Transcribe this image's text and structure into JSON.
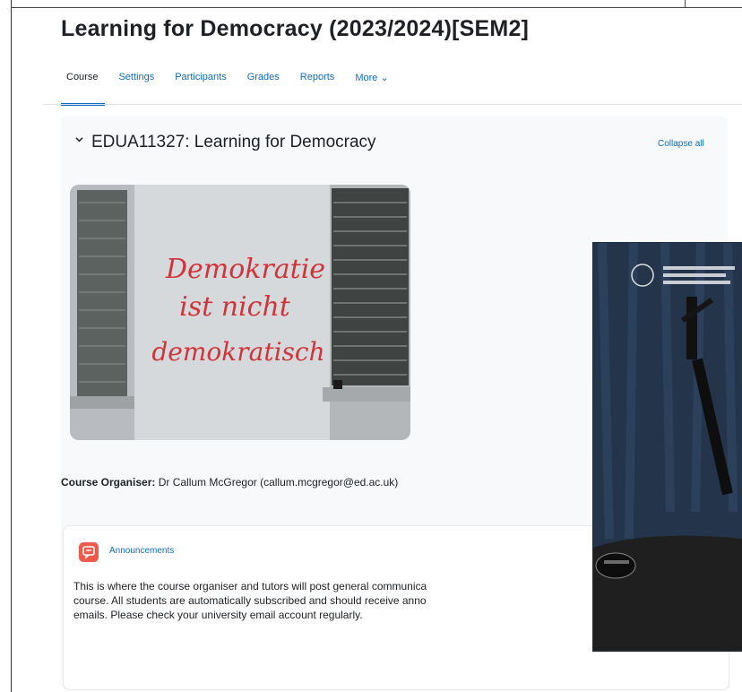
{
  "course": {
    "title": "Learning for Democracy (2023/2024)[SEM2]"
  },
  "tabs": [
    {
      "label": "Course",
      "active": true
    },
    {
      "label": "Settings",
      "active": false
    },
    {
      "label": "Participants",
      "active": false
    },
    {
      "label": "Grades",
      "active": false
    },
    {
      "label": "Reports",
      "active": false
    },
    {
      "label": "More ⌄",
      "active": false
    }
  ],
  "section": {
    "title": "EDUA11327: Learning for Democracy",
    "collapse_label": "Collapse all",
    "chevron_icon": "chevron-down-icon"
  },
  "image": {
    "graffiti_lines": [
      "Demokratie",
      "ist nicht",
      "demokratisch"
    ],
    "graffiti_color": "#d0343a"
  },
  "organiser": {
    "label": "Course Organiser:",
    "value": "Dr Callum McGregor (callum.mcgregor@ed.ac.uk)"
  },
  "announcements": {
    "icon": "forum-icon",
    "link_label": "Announcements",
    "body": "This is where the course organiser and tutors will post general communica\ncourse. All students are automatically subscribed and should receive anno\nemails. Please check your university email account regularly.",
    "icon_color": "#f15a4a"
  },
  "overlay": {
    "type": "video-thumbnail"
  },
  "colors": {
    "accent": "#0f6cbf",
    "section_bg": "#f8f9fa"
  }
}
